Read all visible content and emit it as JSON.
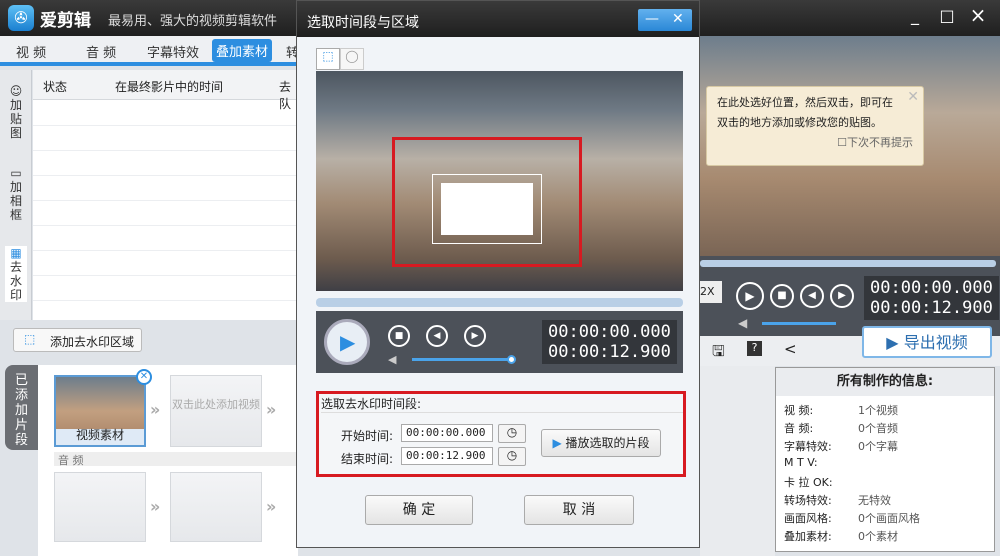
{
  "app": {
    "name": "爱剪辑",
    "tagline": "最易用、强大的视频剪辑软件",
    "win_min": "_",
    "win_max": "□",
    "win_close": "×"
  },
  "tabs": [
    {
      "label": "视 频"
    },
    {
      "label": "音 频"
    },
    {
      "label": "字幕特效"
    },
    {
      "label": "叠加素材",
      "active": true
    },
    {
      "label": "转"
    }
  ],
  "side_tabs": [
    {
      "label": "加贴图"
    },
    {
      "label": "加相框"
    },
    {
      "label": "去水印"
    }
  ],
  "table": {
    "headers": [
      "状态",
      "在最终影片中的时间",
      "去队"
    ]
  },
  "add_area_label": "添加去水印区域",
  "clips": {
    "tab": "已添加片段",
    "clip1": "视频素材",
    "empty": "双击此处添加视频",
    "audio_label": "音 频"
  },
  "dialog": {
    "title": "选取时间段与区域",
    "min": "—",
    "close": "✕",
    "tool_rect": "rect-select",
    "tool_ellipse": "ellipse-select",
    "time_current": "00:00:00.000",
    "time_total": "00:00:12.900",
    "volume": 0.95,
    "section_title": "选取去水印时间段:",
    "start_label": "开始时间:",
    "start_value": "00:00:00.000",
    "end_label": "结束时间:",
    "end_value": "00:00:12.900",
    "play_segment": "播放选取的片段",
    "ok": "确 定",
    "cancel": "取 消"
  },
  "preview": {
    "tip_line1": "在此处选好位置，然后双击，即可在",
    "tip_line2": "双击的地方添加或修改您的贴图。",
    "tip_checkbox": "下次不再提示",
    "speed": "2X",
    "time_current": "00:00:00.000",
    "time_total": "00:00:12.900",
    "export": "导出视频"
  },
  "info": {
    "title": "所有制作的信息:",
    "rows": [
      {
        "label": "视    频:",
        "value": "1个视频"
      },
      {
        "label": "音    频:",
        "value": "0个音频"
      },
      {
        "label": "字幕特效:",
        "value": "0个字幕"
      },
      {
        "label": "M  T  V:",
        "value": ""
      },
      {
        "label": "卡 拉 OK:",
        "value": ""
      },
      {
        "label": "转场特效:",
        "value": "无特效"
      },
      {
        "label": "画面风格:",
        "value": "0个画面风格"
      },
      {
        "label": "叠加素材:",
        "value": "0个素材"
      }
    ]
  }
}
